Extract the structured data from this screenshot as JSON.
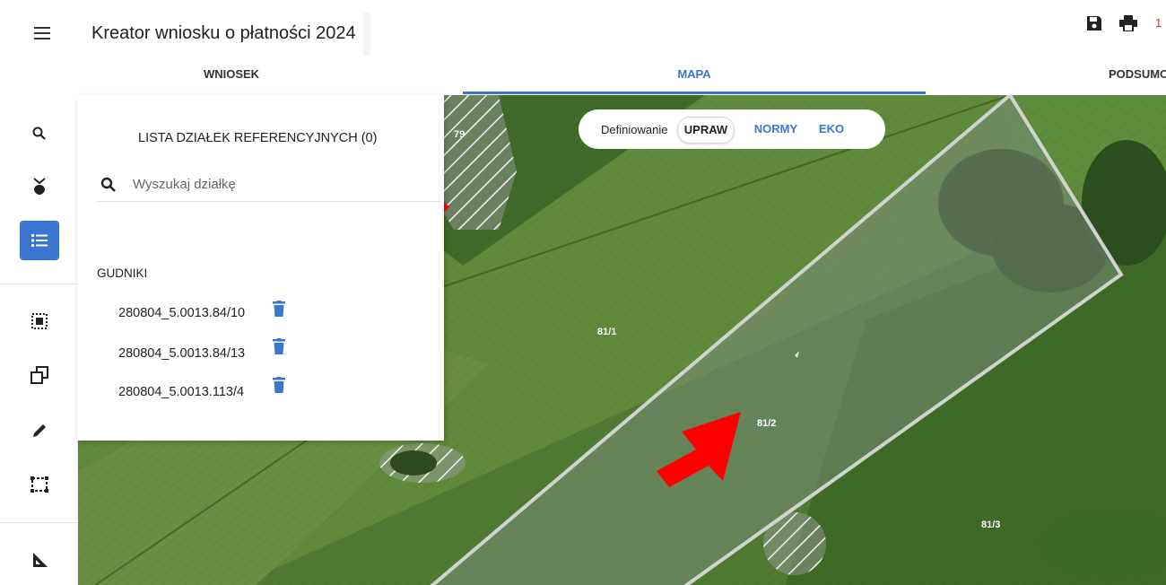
{
  "header": {
    "app_title": "Kreator wniosku o płatności 2024",
    "save_icon": "save-icon",
    "print_icon": "print-icon",
    "badge_text": "1"
  },
  "tabs": [
    {
      "label": "WNIOSEK",
      "active": false
    },
    {
      "label": "MAPA",
      "active": true
    },
    {
      "label": "PODSUMO",
      "active": false
    }
  ],
  "left_rail": {
    "icons": [
      "search-icon",
      "location-pin-icon",
      "list-icon",
      "select-area-icon",
      "copy-icon",
      "pencil-icon",
      "dashed-rectangle-icon",
      "ruler-angle-icon"
    ],
    "active": "list-icon"
  },
  "panel": {
    "title": "LISTA DZIAŁEK REFERENCYJNYCH (0)",
    "search_placeholder": "Wyszukaj działkę",
    "group_label": "GUDNIKI",
    "plots": [
      "280804_5.0013.84/10",
      "280804_5.0013.84/13",
      "280804_5.0013.113/4"
    ]
  },
  "layer_toggle": {
    "label": "Definiowanie",
    "options": [
      "UPRAW",
      "NORMY",
      "EKO"
    ],
    "selected": "UPRAW"
  },
  "map": {
    "parcel_labels": [
      "79",
      "81/1",
      "81/2",
      "81/3"
    ]
  },
  "colors": {
    "accent": "#3a76d0",
    "annotation_arrow": "#ff0000"
  }
}
